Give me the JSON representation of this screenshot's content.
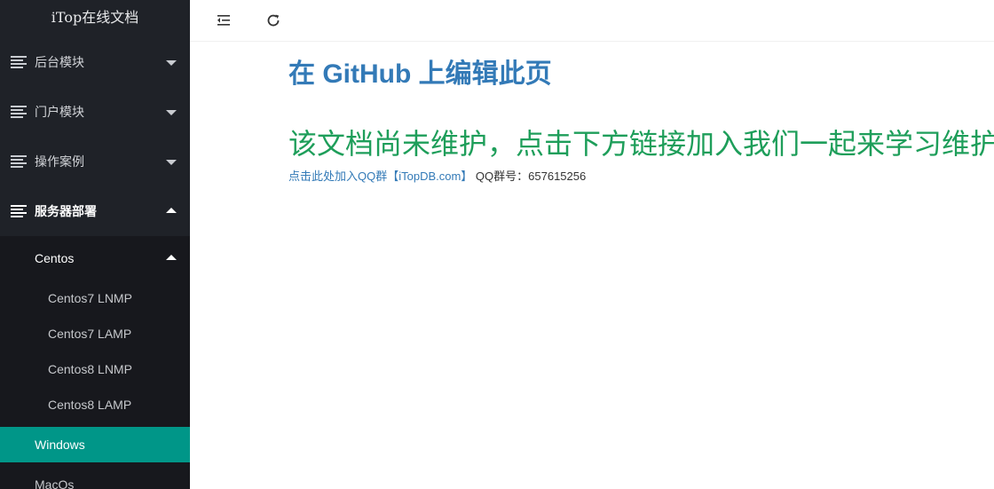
{
  "sidebar": {
    "brand": "iTop在线文档",
    "items": [
      {
        "label": "后台模块"
      },
      {
        "label": "门户模块"
      },
      {
        "label": "操作案例"
      },
      {
        "label": "服务器部署"
      }
    ],
    "centos": {
      "label": "Centos",
      "children": [
        "Centos7 LNMP",
        "Centos7 LAMP",
        "Centos8 LNMP",
        "Centos8 LAMP"
      ]
    },
    "windows": {
      "label": "Windows"
    },
    "macos": {
      "label": "MacOs"
    },
    "active_color": "#009688"
  },
  "toolbar": {
    "collapse_icon": "indent-icon",
    "refresh_icon": "refresh-icon"
  },
  "main": {
    "edit_title": "在 GitHub 上编辑此页",
    "notice": "该文档尚未维护，点击下方链接加入我们一起来学习维护",
    "join_link": "点击此处加入QQ群【iTopDB.com】",
    "qq_text": " QQ群号：657615256"
  }
}
